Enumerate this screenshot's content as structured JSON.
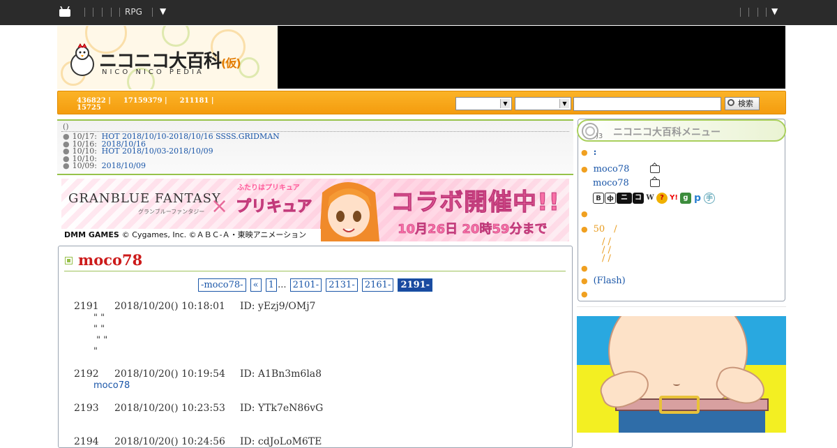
{
  "topbar": {
    "rpg_label": "RPG",
    "caret": "▼",
    "right_caret": "▼"
  },
  "header": {
    "logo_title": "ニコニコ大百科",
    "logo_kari": "(仮)",
    "logo_sub": "NICO NICO PEDIA"
  },
  "stats": {
    "a": "436822 |",
    "b": "17159379 |",
    "c": "211181 |",
    "d": "15725"
  },
  "search": {
    "value": "",
    "button_label": "検索"
  },
  "news": {
    "header": "()",
    "items": [
      {
        "date": "10/17:",
        "text": "HOT 2018/10/10-2018/10/16 SSSS.GRIDMAN"
      },
      {
        "date": "10/16:",
        "text": "2018/10/16"
      },
      {
        "date": "10/10:",
        "text": "HOT 2018/10/03-2018/10/09"
      },
      {
        "date": "10/10:",
        "text": ""
      },
      {
        "date": "10/09:",
        "text": "2018/10/09"
      }
    ]
  },
  "banner": {
    "gbf": "GRANBLUE FANTASY",
    "gbf_sub": "グランブルーファンタジー",
    "x": "×",
    "pc_top": "ふたりはプリキュア",
    "pc": "プリキュア",
    "collab": "コラボ開催中!!",
    "date": "10月26日 20時59分まで",
    "foot_brand": "DMM GAMES",
    "foot_copy": "© Cygames, Inc. ©ＡＢＣ-Ａ・東映アニメーション"
  },
  "article": {
    "title": "moco78",
    "pager": [
      "-moco78-",
      "«",
      "1",
      "...",
      "2101-",
      "2131-",
      "2161-",
      "2191-"
    ],
    "responses": [
      {
        "num": "2191",
        "datetime": "2018/10/20() 10:18:01",
        "id": "ID: yEzj9/OMj7",
        "body": "\" \"\n\" \"\n \" \"\n\""
      },
      {
        "num": "2192",
        "datetime": "2018/10/20() 10:19:54",
        "id": "ID: A1Bn3m6la8",
        "link": "moco78"
      },
      {
        "num": "2193",
        "datetime": "2018/10/20() 10:23:53",
        "id": "ID: YTk7eN86vG"
      },
      {
        "num": "2194",
        "datetime": "2018/10/20() 10:24:56",
        "id": "ID: cdJoLoM6TE"
      }
    ]
  },
  "menu": {
    "title": "ニコニコ大百科メニュー",
    "colon": ":",
    "moco1": "moco78",
    "moco2": "moco78",
    "fifty": "50　/",
    "slash1": "　/ /",
    "slash2": "　/ /",
    "slash3": "　/ /",
    "flash": "(Flash)"
  },
  "colors": {
    "orange": "#f7a51b",
    "green": "#96c34a",
    "link": "#1a56a8",
    "title_red": "#cc1a1a"
  }
}
